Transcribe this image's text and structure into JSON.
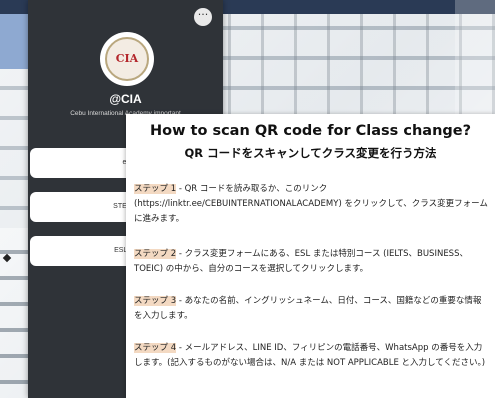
{
  "profile": {
    "more_label": "···",
    "logo_text": "CIA",
    "handle": "@CIA",
    "description": "Cebu International Academy important"
  },
  "links": [
    {
      "label": "e-NOT"
    },
    {
      "label": "STEPS FOR"
    },
    {
      "label": "ESL CLASS"
    }
  ],
  "card": {
    "title": "How to scan QR code for Class change?",
    "subtitle": "QR コードをスキャンしてクラス変更を行う方法",
    "steps": [
      {
        "label": "ステップ 1",
        "text": " - QR コードを読み取るか、このリンク (https://linktr.ee/CEBUINTERNATIONALACADEMY) をクリックして、クラス変更フォームに進みます。"
      },
      {
        "label": "ステップ 2",
        "text": " - クラス変更フォームにある、ESL または特別コース (IELTS、BUSINESS、TOEIC) の中から、自分のコースを選択してクリックします。"
      },
      {
        "label": "ステップ 3",
        "text": " - あなたの名前、イングリッシュネーム、日付、コース、国籍などの重要な情報を入力します。"
      },
      {
        "label": "ステップ 4",
        "text": " - メールアドレス、LINE ID、フィリピンの電話番号、WhatsApp の番号を入力します。(記入するものがない場合は、N/A または NOT APPLICABLE と入力してください。)"
      }
    ]
  }
}
